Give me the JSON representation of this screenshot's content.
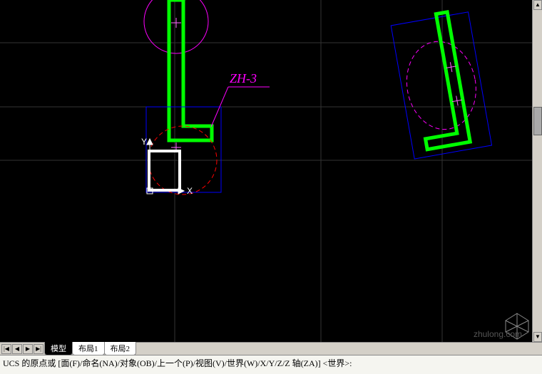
{
  "canvas": {
    "annotation_label": "ZH-3",
    "axis_x": "X",
    "axis_y": "Y",
    "grid_lines_h": [
      60,
      150,
      225
    ],
    "grid_lines_v": [
      245,
      450,
      620
    ]
  },
  "watermark": "zhulong.com",
  "tabs": {
    "nav": [
      "|◀",
      "◀",
      "▶",
      "▶|"
    ],
    "items": [
      "模型",
      "布局1",
      "布局2"
    ],
    "active_index": 0
  },
  "command": {
    "prompt": "UCS 的原点或 [面(F)/命名(NA)/对象(OB)/上一个(P)/视图(V)/世界(W)/X/Y/Z/Z 轴(ZA)] <世界>:"
  },
  "scrollbar": {
    "up": "▲",
    "down": "▼"
  }
}
